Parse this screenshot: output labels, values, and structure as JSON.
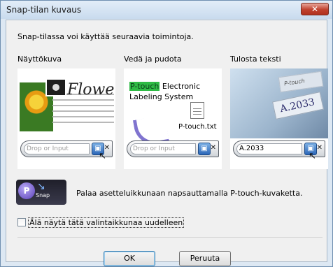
{
  "window": {
    "title": "Snap-tilan kuvaus",
    "close_icon": "close-icon"
  },
  "intro": "Snap-tilassa voi käyttää seuraavia toimintoja.",
  "panels": [
    {
      "label": "Näyttökuva",
      "image_text": "Flower",
      "input_placeholder": "Drop or Input"
    },
    {
      "label": "Vedä ja pudota",
      "highlight_text": "P-touch",
      "text_line1_rest": " Electronic",
      "text_line2": "Labeling System",
      "file_name": "P-touch.txt",
      "input_placeholder": "Drop or Input"
    },
    {
      "label": "Tulosta teksti",
      "tape_text": "A.2033",
      "tape_top_text": "P-touch",
      "input_value": "A.2033"
    }
  ],
  "snap_icon": {
    "label": "Snap",
    "glyph": "P"
  },
  "return_text": "Palaa asetteluikkunaan napsauttamalla P-touch-kuvaketta.",
  "checkbox": {
    "label": "Älä näytä tätä valintaikkunaa uudelleen",
    "checked": false
  },
  "buttons": {
    "ok": "OK",
    "cancel": "Peruuta"
  }
}
